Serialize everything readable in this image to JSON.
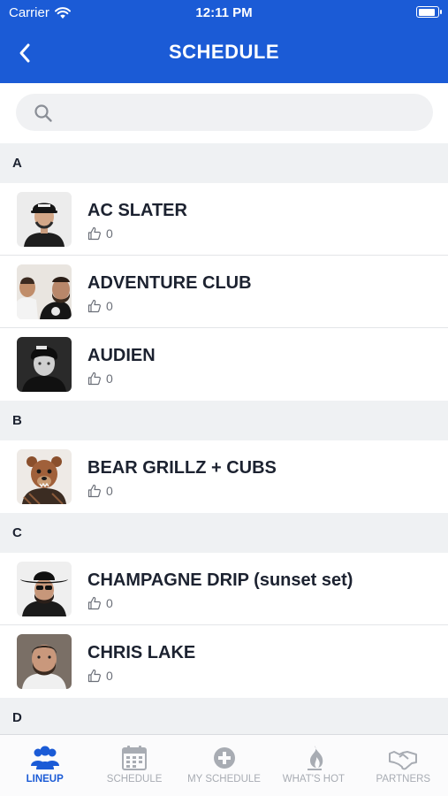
{
  "status_bar": {
    "carrier": "Carrier",
    "time": "12:11 PM",
    "battery_level": 0.9
  },
  "nav": {
    "title": "SCHEDULE",
    "back_icon": "chevron-left-icon"
  },
  "search": {
    "placeholder": "",
    "value": ""
  },
  "sections": [
    {
      "letter": "A",
      "artists": [
        {
          "name": "AC SLATER",
          "likes": "0"
        },
        {
          "name": "ADVENTURE CLUB",
          "likes": "0"
        },
        {
          "name": "AUDIEN",
          "likes": "0"
        }
      ]
    },
    {
      "letter": "B",
      "artists": [
        {
          "name": "BEAR GRILLZ + CUBS",
          "likes": "0"
        }
      ]
    },
    {
      "letter": "C",
      "artists": [
        {
          "name": "CHAMPAGNE DRIP (sunset set)",
          "likes": "0"
        },
        {
          "name": "CHRIS LAKE",
          "likes": "0"
        }
      ]
    },
    {
      "letter": "D",
      "artists": []
    }
  ],
  "tabs": [
    {
      "label": "LINEUP",
      "icon": "people-icon",
      "active": true
    },
    {
      "label": "SCHEDULE",
      "icon": "calendar-icon",
      "active": false
    },
    {
      "label": "MY SCHEDULE",
      "icon": "plus-circle-icon",
      "active": false
    },
    {
      "label": "WHAT'S HOT",
      "icon": "flame-icon",
      "active": false
    },
    {
      "label": "PARTNERS",
      "icon": "handshake-icon",
      "active": false
    }
  ],
  "colors": {
    "brand": "#1b5bd6",
    "section_bg": "#eff1f3",
    "inactive_tab": "#a8acb3"
  }
}
